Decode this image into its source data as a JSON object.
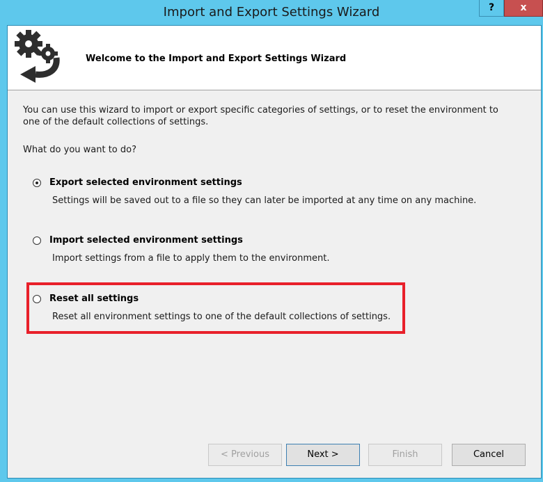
{
  "window": {
    "title": "Import and Export Settings Wizard",
    "help_label": "?",
    "close_label": "x"
  },
  "header": {
    "icon": "gears-arrow-icon",
    "title": "Welcome to the Import and Export Settings Wizard"
  },
  "content": {
    "intro": "You can use this wizard to import or export specific categories of settings, or to reset the environment to one of the default collections of settings.",
    "question": "What do you want to do?",
    "options": [
      {
        "label": "Export selected environment settings",
        "description": "Settings will be saved out to a file so they can later be imported at any time on any machine.",
        "selected": true
      },
      {
        "label": "Import selected environment settings",
        "description": "Import settings from a file to apply them to the environment.",
        "selected": false
      },
      {
        "label": "Reset all settings",
        "description": "Reset all environment settings to one of the default collections of settings.",
        "selected": false
      }
    ]
  },
  "footer": {
    "previous_label": "< Previous",
    "next_label": "Next >",
    "finish_label": "Finish",
    "cancel_label": "Cancel"
  },
  "colors": {
    "titlebar": "#5ec8ec",
    "close_button": "#c75050",
    "highlight": "#e8202a",
    "dialog_background": "#f0f0f0"
  }
}
